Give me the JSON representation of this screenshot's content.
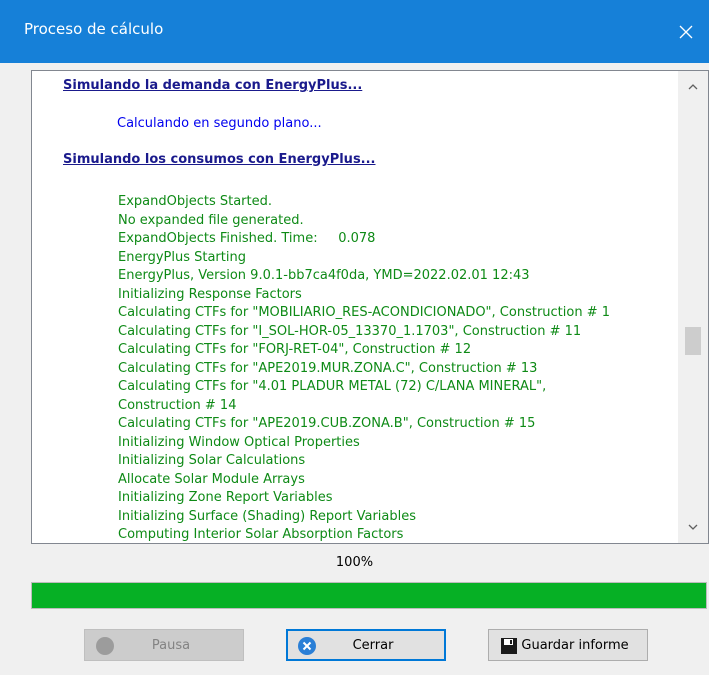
{
  "window": {
    "title": "Proceso de cálculo"
  },
  "log": {
    "heading1": "Simulando la demanda con EnergyPlus...",
    "line_bg": "Calculando en segundo plano...",
    "heading2": "Simulando los consumos con EnergyPlus...",
    "lines": [
      "ExpandObjects Started.",
      "No expanded file generated.",
      "ExpandObjects Finished. Time:     0.078",
      "EnergyPlus Starting",
      "EnergyPlus, Version 9.0.1-bb7ca4f0da, YMD=2022.02.01 12:43",
      "Initializing Response Factors",
      "Calculating CTFs for \"MOBILIARIO_RES-ACONDICIONADO\", Construction # 1",
      "Calculating CTFs for \"I_SOL-HOR-05_13370_1.1703\", Construction # 11",
      "Calculating CTFs for \"FORJ-RET-04\", Construction # 12",
      "Calculating CTFs for \"APE2019.MUR.ZONA.C\", Construction # 13",
      "Calculating CTFs for \"4.01 PLADUR METAL (72) C/LANA MINERAL\",",
      "Construction # 14",
      "Calculating CTFs for \"APE2019.CUB.ZONA.B\", Construction # 15",
      "Initializing Window Optical Properties",
      "Initializing Solar Calculations",
      "Allocate Solar Module Arrays",
      "Initializing Zone Report Variables",
      "Initializing Surface (Shading) Report Variables",
      "Computing Interior Solar Absorption Factors"
    ]
  },
  "progress": {
    "label": "100%",
    "fraction": 1.0,
    "color": "#06b025"
  },
  "buttons": {
    "pause": "Pausa",
    "close": "Cerrar",
    "save": "Guardar informe"
  },
  "colors": {
    "titlebar": "#1680d8",
    "log_green": "#0e8a16",
    "heading": "#1a1a8c"
  },
  "icons": [
    "close-icon",
    "scroll-up-icon",
    "scroll-down-icon",
    "pause-icon",
    "close-circle-icon",
    "save-disk-icon"
  ]
}
